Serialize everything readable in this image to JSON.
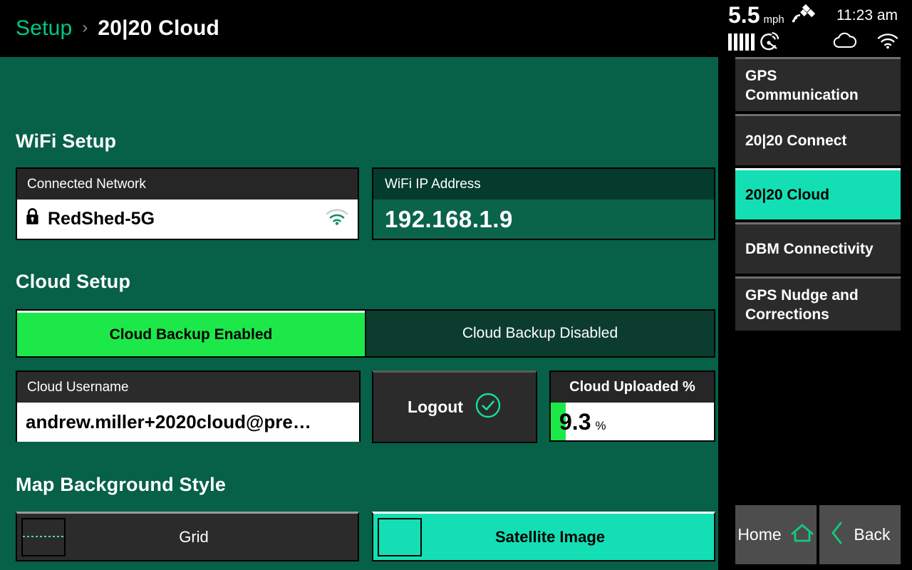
{
  "breadcrumb": {
    "parent": "Setup",
    "separator": "›",
    "current": "20|20 Cloud"
  },
  "status_bar": {
    "speed_value": "5.5",
    "speed_unit": "mph",
    "satellite_icon": "satellite-icon",
    "signal_bars": 5,
    "dish_icon": "satellite-dish-icon",
    "time": "11:23 am",
    "cloud_icon": "cloud-icon",
    "wifi_icon": "wifi-icon"
  },
  "wifi_setup": {
    "title": "WiFi Setup",
    "connected_network_label": "Connected Network",
    "connected_network_value": "RedShed-5G",
    "lock_icon": "lock-icon",
    "signal_icon": "wifi-signal-icon",
    "ip_label": "WiFi IP Address",
    "ip_value": "192.168.1.9"
  },
  "cloud_setup": {
    "title": "Cloud Setup",
    "backup_enabled_label": "Cloud Backup Enabled",
    "backup_disabled_label": "Cloud Backup Disabled",
    "backup_selected": "enabled",
    "username_label": "Cloud Username",
    "username_value": "andrew.miller+2020cloud@pre…",
    "logout_label": "Logout",
    "logout_icon": "check-circle-icon",
    "uploaded_label": "Cloud Uploaded %",
    "uploaded_value": "9.3",
    "uploaded_unit": "%",
    "uploaded_percent": 9.3
  },
  "map_background": {
    "title": "Map Background Style",
    "options": [
      {
        "label": "Grid",
        "selected": false,
        "thumb": "grid-thumbnail"
      },
      {
        "label": "Satellite Image",
        "selected": true,
        "thumb": "satellite-thumbnail"
      }
    ]
  },
  "sidebar": {
    "items": [
      {
        "label": "GPS Communication",
        "selected": false
      },
      {
        "label": "20|20 Connect",
        "selected": false
      },
      {
        "label": "20|20 Cloud",
        "selected": true
      },
      {
        "label": "DBM Connectivity",
        "selected": false
      },
      {
        "label": "GPS Nudge and Corrections",
        "selected": false
      }
    ],
    "home_label": "Home",
    "home_icon": "home-icon",
    "back_label": "Back",
    "back_icon": "chevron-left-icon"
  },
  "colors": {
    "background_green": "#076048",
    "accent_teal": "#14dfb4",
    "accent_green": "#00c88a",
    "enabled_green": "#1de84a",
    "panel_dark": "#2b2b2b"
  }
}
